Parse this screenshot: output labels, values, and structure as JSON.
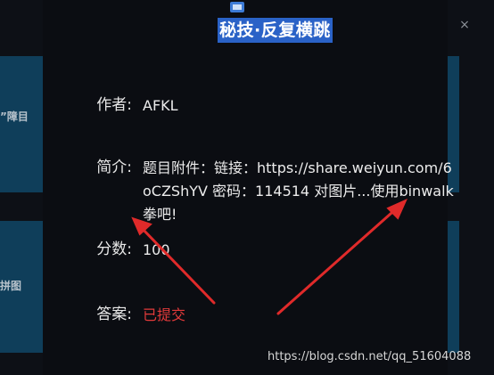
{
  "modal": {
    "title": "秘技·反复横跳",
    "close_glyph": "×",
    "fields": {
      "author": {
        "label": "作者:",
        "value": "AFKL"
      },
      "intro": {
        "label": "简介:",
        "value": "题目附件：链接：https://share.weiyun.com/6oCZShYV 密码：114514 对图片...使用binwalk拳吧!"
      },
      "score": {
        "label": "分数:",
        "value": "100"
      },
      "answer": {
        "label": "答案:",
        "value": "已提交"
      }
    }
  },
  "background": {
    "card1_text": "”障目",
    "card2_text": "拼图"
  },
  "watermark": "https://blog.csdn.net/qq_51604088",
  "colors": {
    "accent": "#2a62c7",
    "submitted": "#e23a3a",
    "arrow": "#e02a2a",
    "card": "#0f3e5a"
  },
  "icons": [
    "app-icon",
    "close-icon"
  ]
}
